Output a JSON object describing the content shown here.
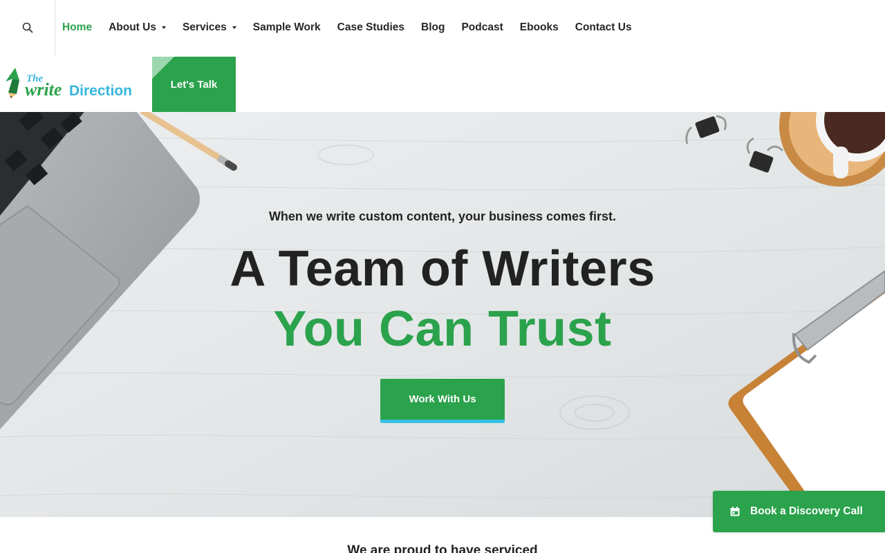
{
  "nav": {
    "search_icon": "search-icon",
    "items": [
      {
        "label": "Home",
        "active": true,
        "dropdown": false
      },
      {
        "label": "About Us",
        "active": false,
        "dropdown": true
      },
      {
        "label": "Services",
        "active": false,
        "dropdown": true
      },
      {
        "label": "Sample Work",
        "active": false,
        "dropdown": false
      },
      {
        "label": "Case Studies",
        "active": false,
        "dropdown": false
      },
      {
        "label": "Blog",
        "active": false,
        "dropdown": false
      },
      {
        "label": "Podcast",
        "active": false,
        "dropdown": false
      },
      {
        "label": "Ebooks",
        "active": false,
        "dropdown": false
      },
      {
        "label": "Contact Us",
        "active": false,
        "dropdown": false
      }
    ]
  },
  "logo": {
    "line1": "The",
    "line2a": "write",
    "line2b": "Direction"
  },
  "header": {
    "cta_label": "Let's Talk"
  },
  "hero": {
    "tagline": "When we write custom content, your business comes first.",
    "headline_line1": "A Team of Writers",
    "headline_line2": "You Can Trust",
    "button_label": "Work With Us"
  },
  "floating": {
    "label": "Book a Discovery Call",
    "icon": "calendar-icon"
  },
  "below": {
    "heading": "We are proud to have serviced"
  },
  "colors": {
    "brand_green": "#2ba24c",
    "accent_blue": "#35c0e3",
    "text_dark": "#222222",
    "logo_blue": "#35b6dc"
  }
}
